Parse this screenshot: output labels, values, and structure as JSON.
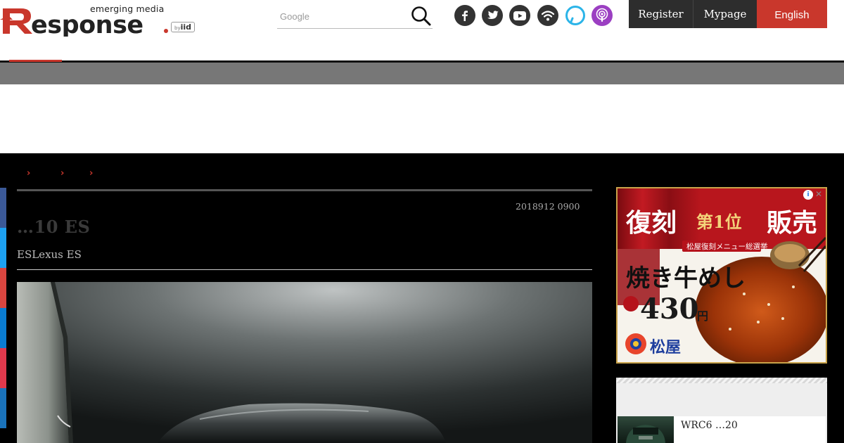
{
  "header": {
    "logo": {
      "tagline": "emerging media",
      "wordmark": "Response.",
      "badge_by": "by",
      "badge": "iid"
    },
    "search": {
      "placeholder": "Google"
    },
    "social_icons": [
      "facebook-icon",
      "twitter-icon",
      "youtube-icon",
      "rss-icon",
      "alexa-icon",
      "podcast-icon"
    ],
    "nav": {
      "register": "Register",
      "mypage": "Mypage",
      "english": "English"
    }
  },
  "breadcrumb": {
    "separators": [
      "›",
      "›",
      "›"
    ]
  },
  "article": {
    "date": "2018912 0900",
    "title": "…10 ES",
    "subtitle": "ESLexus ES"
  },
  "sidebar": {
    "ad": {
      "info_label": "i",
      "close_label": "✕",
      "headline_left": "復刻",
      "headline_rank": "第1位",
      "headline_right": "販売",
      "ribbon": "松屋復刻メニュー総選挙",
      "product": "焼き牛めし",
      "price": "430",
      "price_unit": "円",
      "brand": "松屋"
    },
    "ranking": {
      "items": [
        {
          "title": "WRC6 …20"
        }
      ]
    }
  },
  "colors": {
    "accent_red": "#c9372c",
    "dark_nav": "#2d2d2d",
    "band_gray": "#777777",
    "main_bg": "#000000",
    "share_facebook": "#3b5998",
    "share_twitter": "#1da1f2",
    "share_hatena": "#d9453f",
    "share_line": "#0a7cd1",
    "share_pocket": "#e0394c",
    "share_other": "#1a73bb"
  }
}
